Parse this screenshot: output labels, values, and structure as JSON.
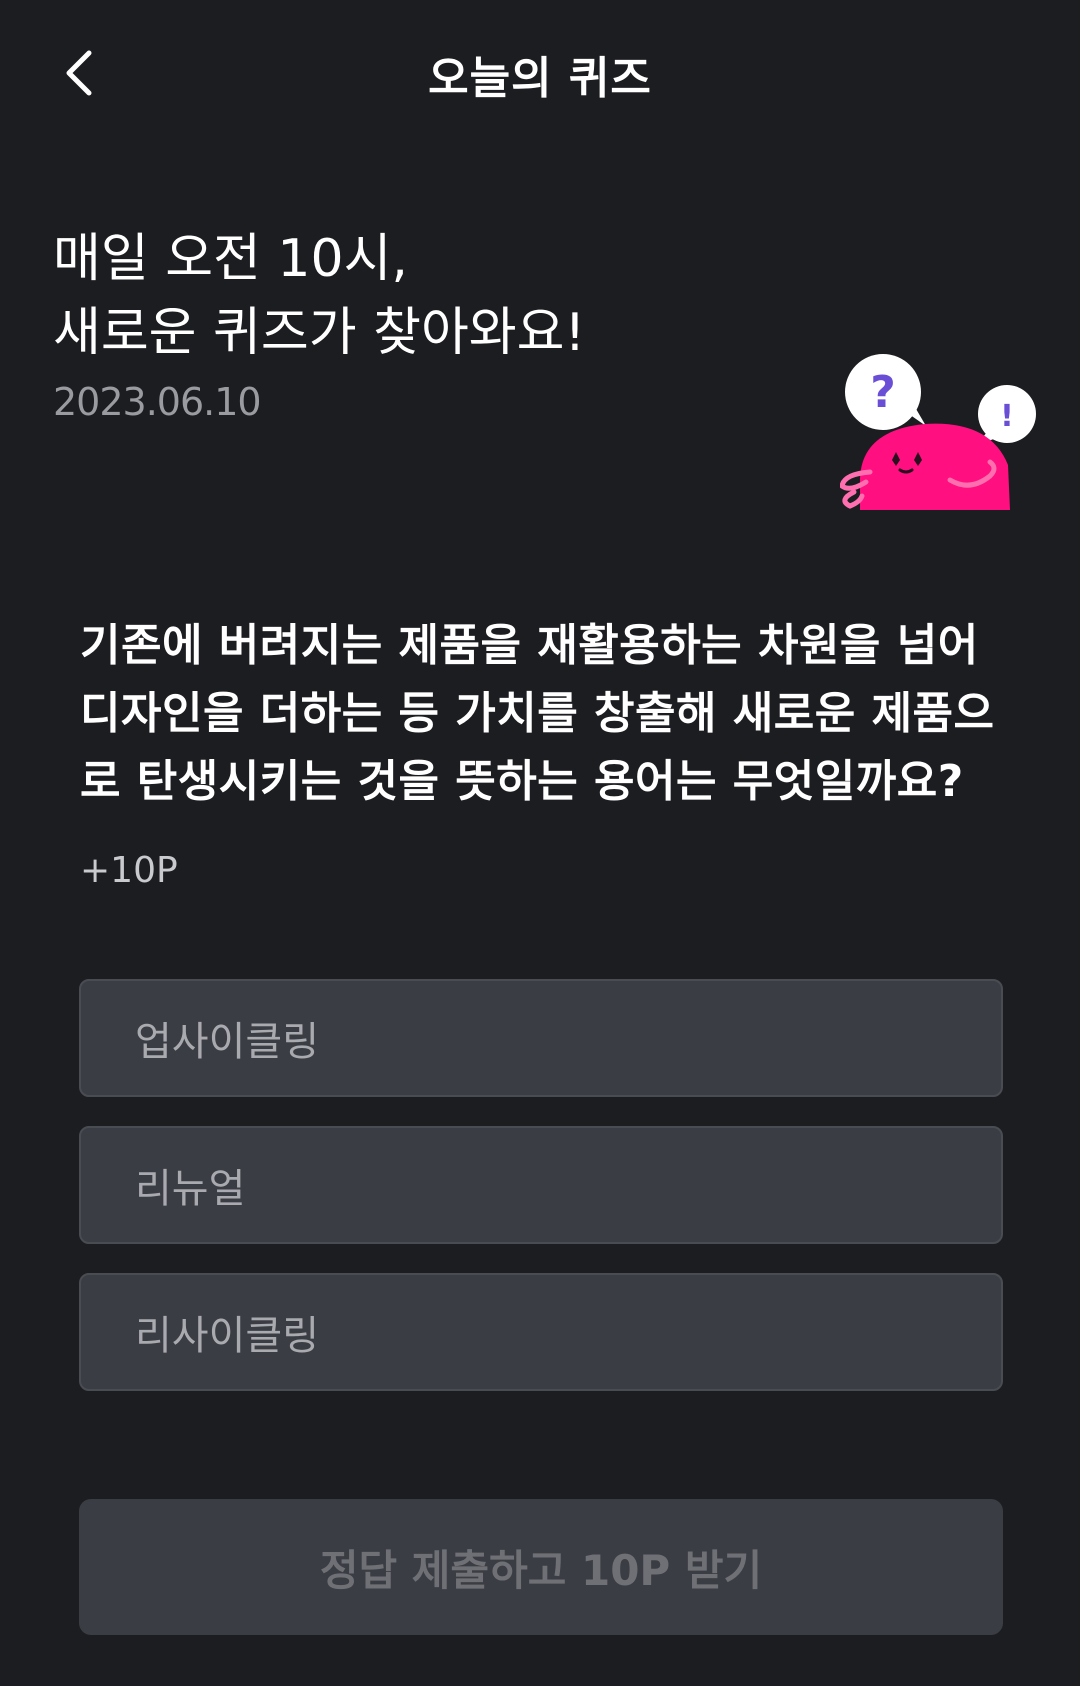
{
  "header": {
    "title": "오늘의 퀴즈",
    "back_icon": "chevron-left-icon"
  },
  "intro": {
    "line1": "매일 오전 10시,",
    "line2": "새로운 퀴즈가 찾아와요!",
    "date": "2023.06.10"
  },
  "mascot": {
    "icon": "quiz-mascot-illustration",
    "bubble_question_mark": "?",
    "bubble_exclamation_mark": "!",
    "colors": {
      "body": "#ff0f80",
      "bubble": "#ffffff",
      "mark": "#6a4fd6"
    }
  },
  "question": {
    "text": "기존에 버려지는 제품을 재활용하는 차원을 넘어 디자인을 더하는 등 가치를 창출해 새로운 제품으로 탄생시키는 것을 뜻하는 용어는 무엇일까요?",
    "points": "+10P"
  },
  "options": [
    {
      "label": "업사이클링"
    },
    {
      "label": "리뉴얼"
    },
    {
      "label": "리사이클링"
    }
  ],
  "submit": {
    "label": "정답 제출하고 10P 받기"
  },
  "colors": {
    "background": "#1c1d21",
    "option_bg": "#3b3d44",
    "muted_text": "#9a9ba0",
    "disabled_text": "#6f7076"
  }
}
